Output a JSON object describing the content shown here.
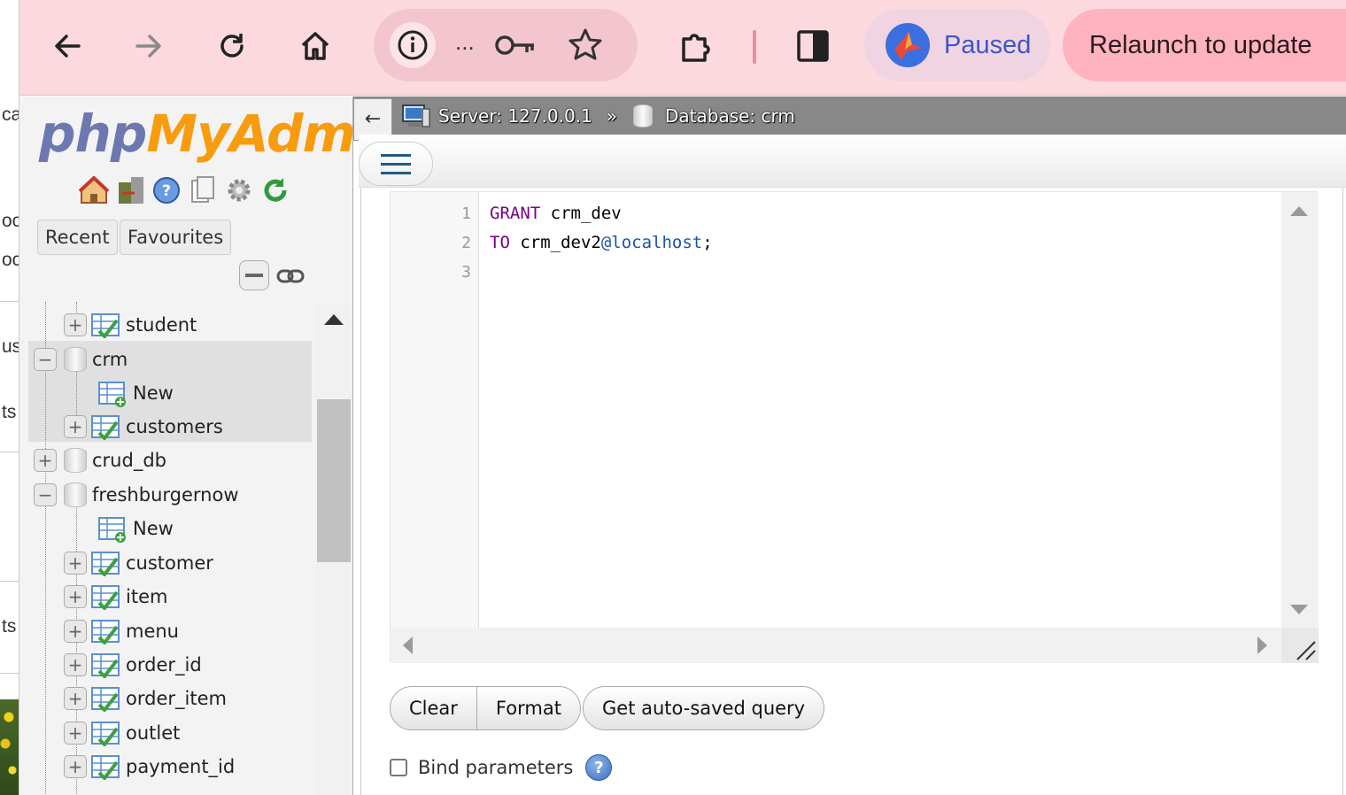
{
  "left_strip": {
    "fragments": [
      "ca",
      "oc",
      "oc",
      "us",
      "ts",
      "ts"
    ]
  },
  "browser": {
    "omnibox": {
      "ellipsis": "..."
    },
    "profile": {
      "status": "Paused"
    },
    "relaunch": {
      "label": "Relaunch to update"
    }
  },
  "pma": {
    "logo": {
      "part1": "php",
      "part2": "MyAdmin"
    },
    "tabs": {
      "recent": "Recent",
      "favourites": "Favourites"
    },
    "tree": [
      {
        "label": "student",
        "type": "table",
        "expander": "+"
      },
      {
        "label": "crm",
        "type": "db",
        "expander": "−"
      },
      {
        "label": "New",
        "type": "new"
      },
      {
        "label": "customers",
        "type": "table",
        "expander": "+"
      },
      {
        "label": "crud_db",
        "type": "db",
        "expander": "+"
      },
      {
        "label": "freshburgernow",
        "type": "db",
        "expander": "−"
      },
      {
        "label": "New",
        "type": "new"
      },
      {
        "label": "customer",
        "type": "table",
        "expander": "+"
      },
      {
        "label": "item",
        "type": "table",
        "expander": "+"
      },
      {
        "label": "menu",
        "type": "table",
        "expander": "+"
      },
      {
        "label": "order_id",
        "type": "table",
        "expander": "+"
      },
      {
        "label": "order_item",
        "type": "table",
        "expander": "+"
      },
      {
        "label": "outlet",
        "type": "table",
        "expander": "+"
      },
      {
        "label": "payment_id",
        "type": "table",
        "expander": "+"
      }
    ]
  },
  "breadcrumb": {
    "back": "←",
    "server": "Server: 127.0.0.1",
    "separator": "»",
    "database": "Database: crm"
  },
  "editor": {
    "lines": [
      {
        "num": "1",
        "kw": "GRANT",
        "rest": " crm_dev",
        "at": "",
        "tail": ""
      },
      {
        "num": "2",
        "kw": "TO",
        "rest": " crm_dev2",
        "at": "@localhost",
        "tail": ";"
      },
      {
        "num": "3",
        "kw": "",
        "rest": "",
        "at": "",
        "tail": ""
      }
    ]
  },
  "buttons": {
    "clear": "Clear",
    "format": "Format",
    "autosaved": "Get auto-saved query"
  },
  "bind": {
    "label": "Bind parameters",
    "help": "?"
  }
}
